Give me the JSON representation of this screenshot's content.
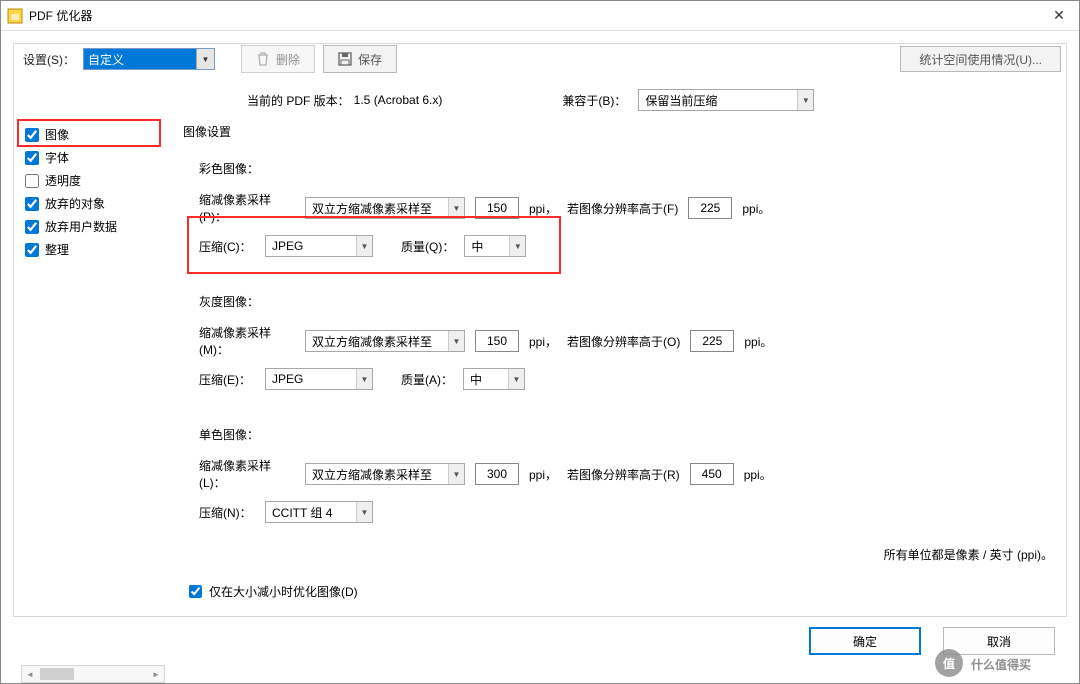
{
  "window": {
    "title": "PDF 优化器"
  },
  "toolbar": {
    "settings_label": "设置(S)：",
    "preset_value": "自定义",
    "delete_label": "删除",
    "save_label": "保存",
    "audit_label": "统计空间使用情况(U)..."
  },
  "version": {
    "current_label": "当前的 PDF 版本：",
    "current_value": "1.5 (Acrobat 6.x)",
    "compat_label": "兼容于(B)：",
    "compat_value": "保留当前压缩"
  },
  "sidebar": {
    "items": [
      {
        "label": "图像",
        "checked": true
      },
      {
        "label": "字体",
        "checked": true
      },
      {
        "label": "透明度",
        "checked": false
      },
      {
        "label": "放弃的对象",
        "checked": true
      },
      {
        "label": "放弃用户数据",
        "checked": true
      },
      {
        "label": "整理",
        "checked": true
      }
    ]
  },
  "content": {
    "heading": "图像设置",
    "color": {
      "title": "彩色图像：",
      "downsample_label": "缩减像素采样(P)：",
      "downsample_value": "双立方缩减像素采样至",
      "ppi1": "150",
      "ppi_unit": "ppi，",
      "above_label": "若图像分辨率高于(F)",
      "ppi2": "225",
      "ppi_unit2": "ppi。",
      "compress_label": "压缩(C)：",
      "compress_value": "JPEG",
      "quality_label": "质量(Q)：",
      "quality_value": "中"
    },
    "gray": {
      "title": "灰度图像：",
      "downsample_label": "缩减像素采样(M)：",
      "downsample_value": "双立方缩减像素采样至",
      "ppi1": "150",
      "ppi_unit": "ppi，",
      "above_label": "若图像分辨率高于(O)",
      "ppi2": "225",
      "ppi_unit2": "ppi。",
      "compress_label": "压缩(E)：",
      "compress_value": "JPEG",
      "quality_label": "质量(A)：",
      "quality_value": "中"
    },
    "mono": {
      "title": "单色图像：",
      "downsample_label": "缩减像素采样(L)：",
      "downsample_value": "双立方缩减像素采样至",
      "ppi1": "300",
      "ppi_unit": "ppi，",
      "above_label": "若图像分辨率高于(R)",
      "ppi2": "450",
      "ppi_unit2": "ppi。",
      "compress_label": "压缩(N)：",
      "compress_value": "CCITT 组 4"
    },
    "units_note": "所有单位都是像素 / 英寸 (ppi)。",
    "only_shrink_label": "仅在大小减小时优化图像(D)"
  },
  "buttons": {
    "ok": "确定",
    "cancel": "取消"
  },
  "watermark": "值 什么值得买"
}
